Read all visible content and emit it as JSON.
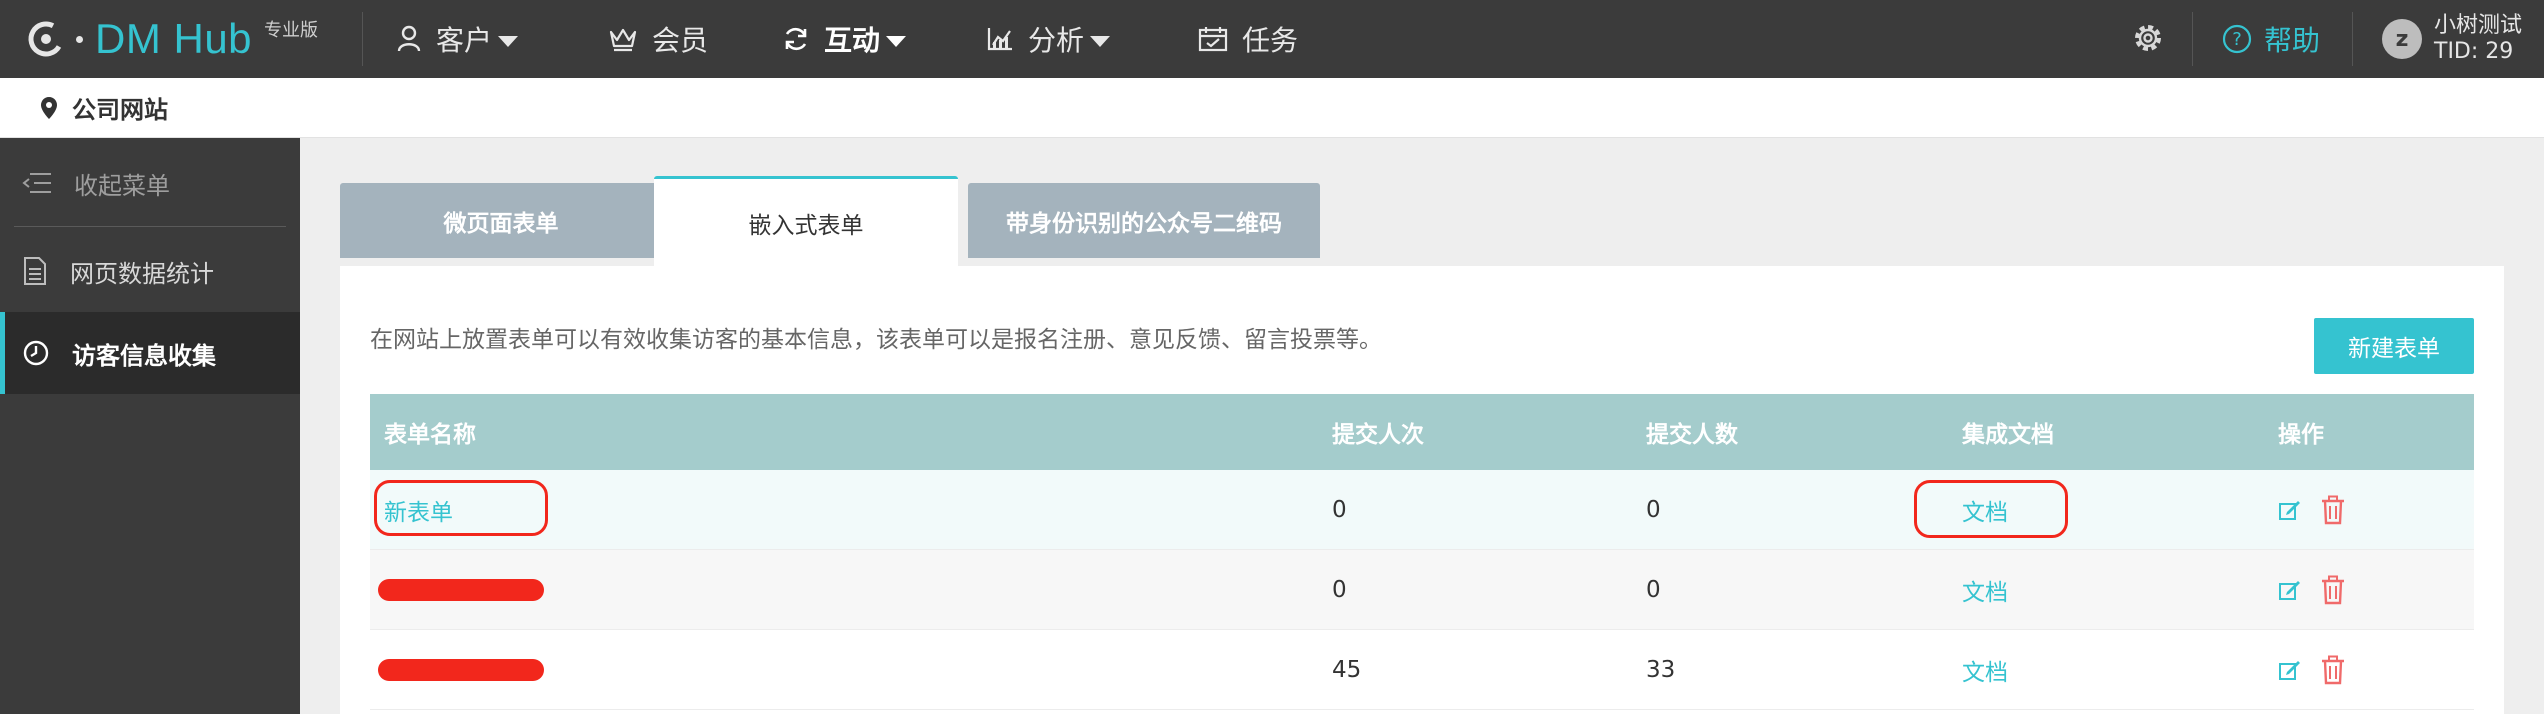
{
  "brand": {
    "name": "DM Hub",
    "edition": "专业版"
  },
  "nav": {
    "items": [
      {
        "label": "客户"
      },
      {
        "label": "会员"
      },
      {
        "label": "互动"
      },
      {
        "label": "分析"
      },
      {
        "label": "任务"
      }
    ],
    "help_label": "帮助",
    "user": {
      "avatar_initial": "z",
      "name": "小树测试",
      "tid": "TID: 29"
    }
  },
  "breadcrumb": {
    "label": "公司网站"
  },
  "sidebar": {
    "items": [
      {
        "label": "收起菜单"
      },
      {
        "label": "网页数据统计"
      },
      {
        "label": "访客信息收集"
      }
    ]
  },
  "tabs": [
    {
      "label": "微页面表单"
    },
    {
      "label": "嵌入式表单"
    },
    {
      "label": "带身份识别的公众号二维码"
    }
  ],
  "panel": {
    "intro": "在网站上放置表单可以有效收集访客的基本信息，该表单可以是报名注册、意见反馈、留言投票等。",
    "new_button": "新建表单"
  },
  "table": {
    "headers": [
      "表单名称",
      "提交人次",
      "提交人数",
      "集成文档",
      "操作"
    ],
    "rows": [
      {
        "name": "新表单",
        "submissions": "0",
        "submitters": "0",
        "doc": "文档"
      },
      {
        "name": "",
        "submissions": "0",
        "submitters": "0",
        "doc": "文档"
      },
      {
        "name": "",
        "submissions": "45",
        "submitters": "33",
        "doc": "文档"
      }
    ]
  },
  "colors": {
    "accent": "#35c3d0",
    "nav_bg": "#3b3b3b",
    "header_row": "#a4cccc",
    "tab_inactive": "#a4b3bd",
    "annotation": "#f2271c"
  }
}
